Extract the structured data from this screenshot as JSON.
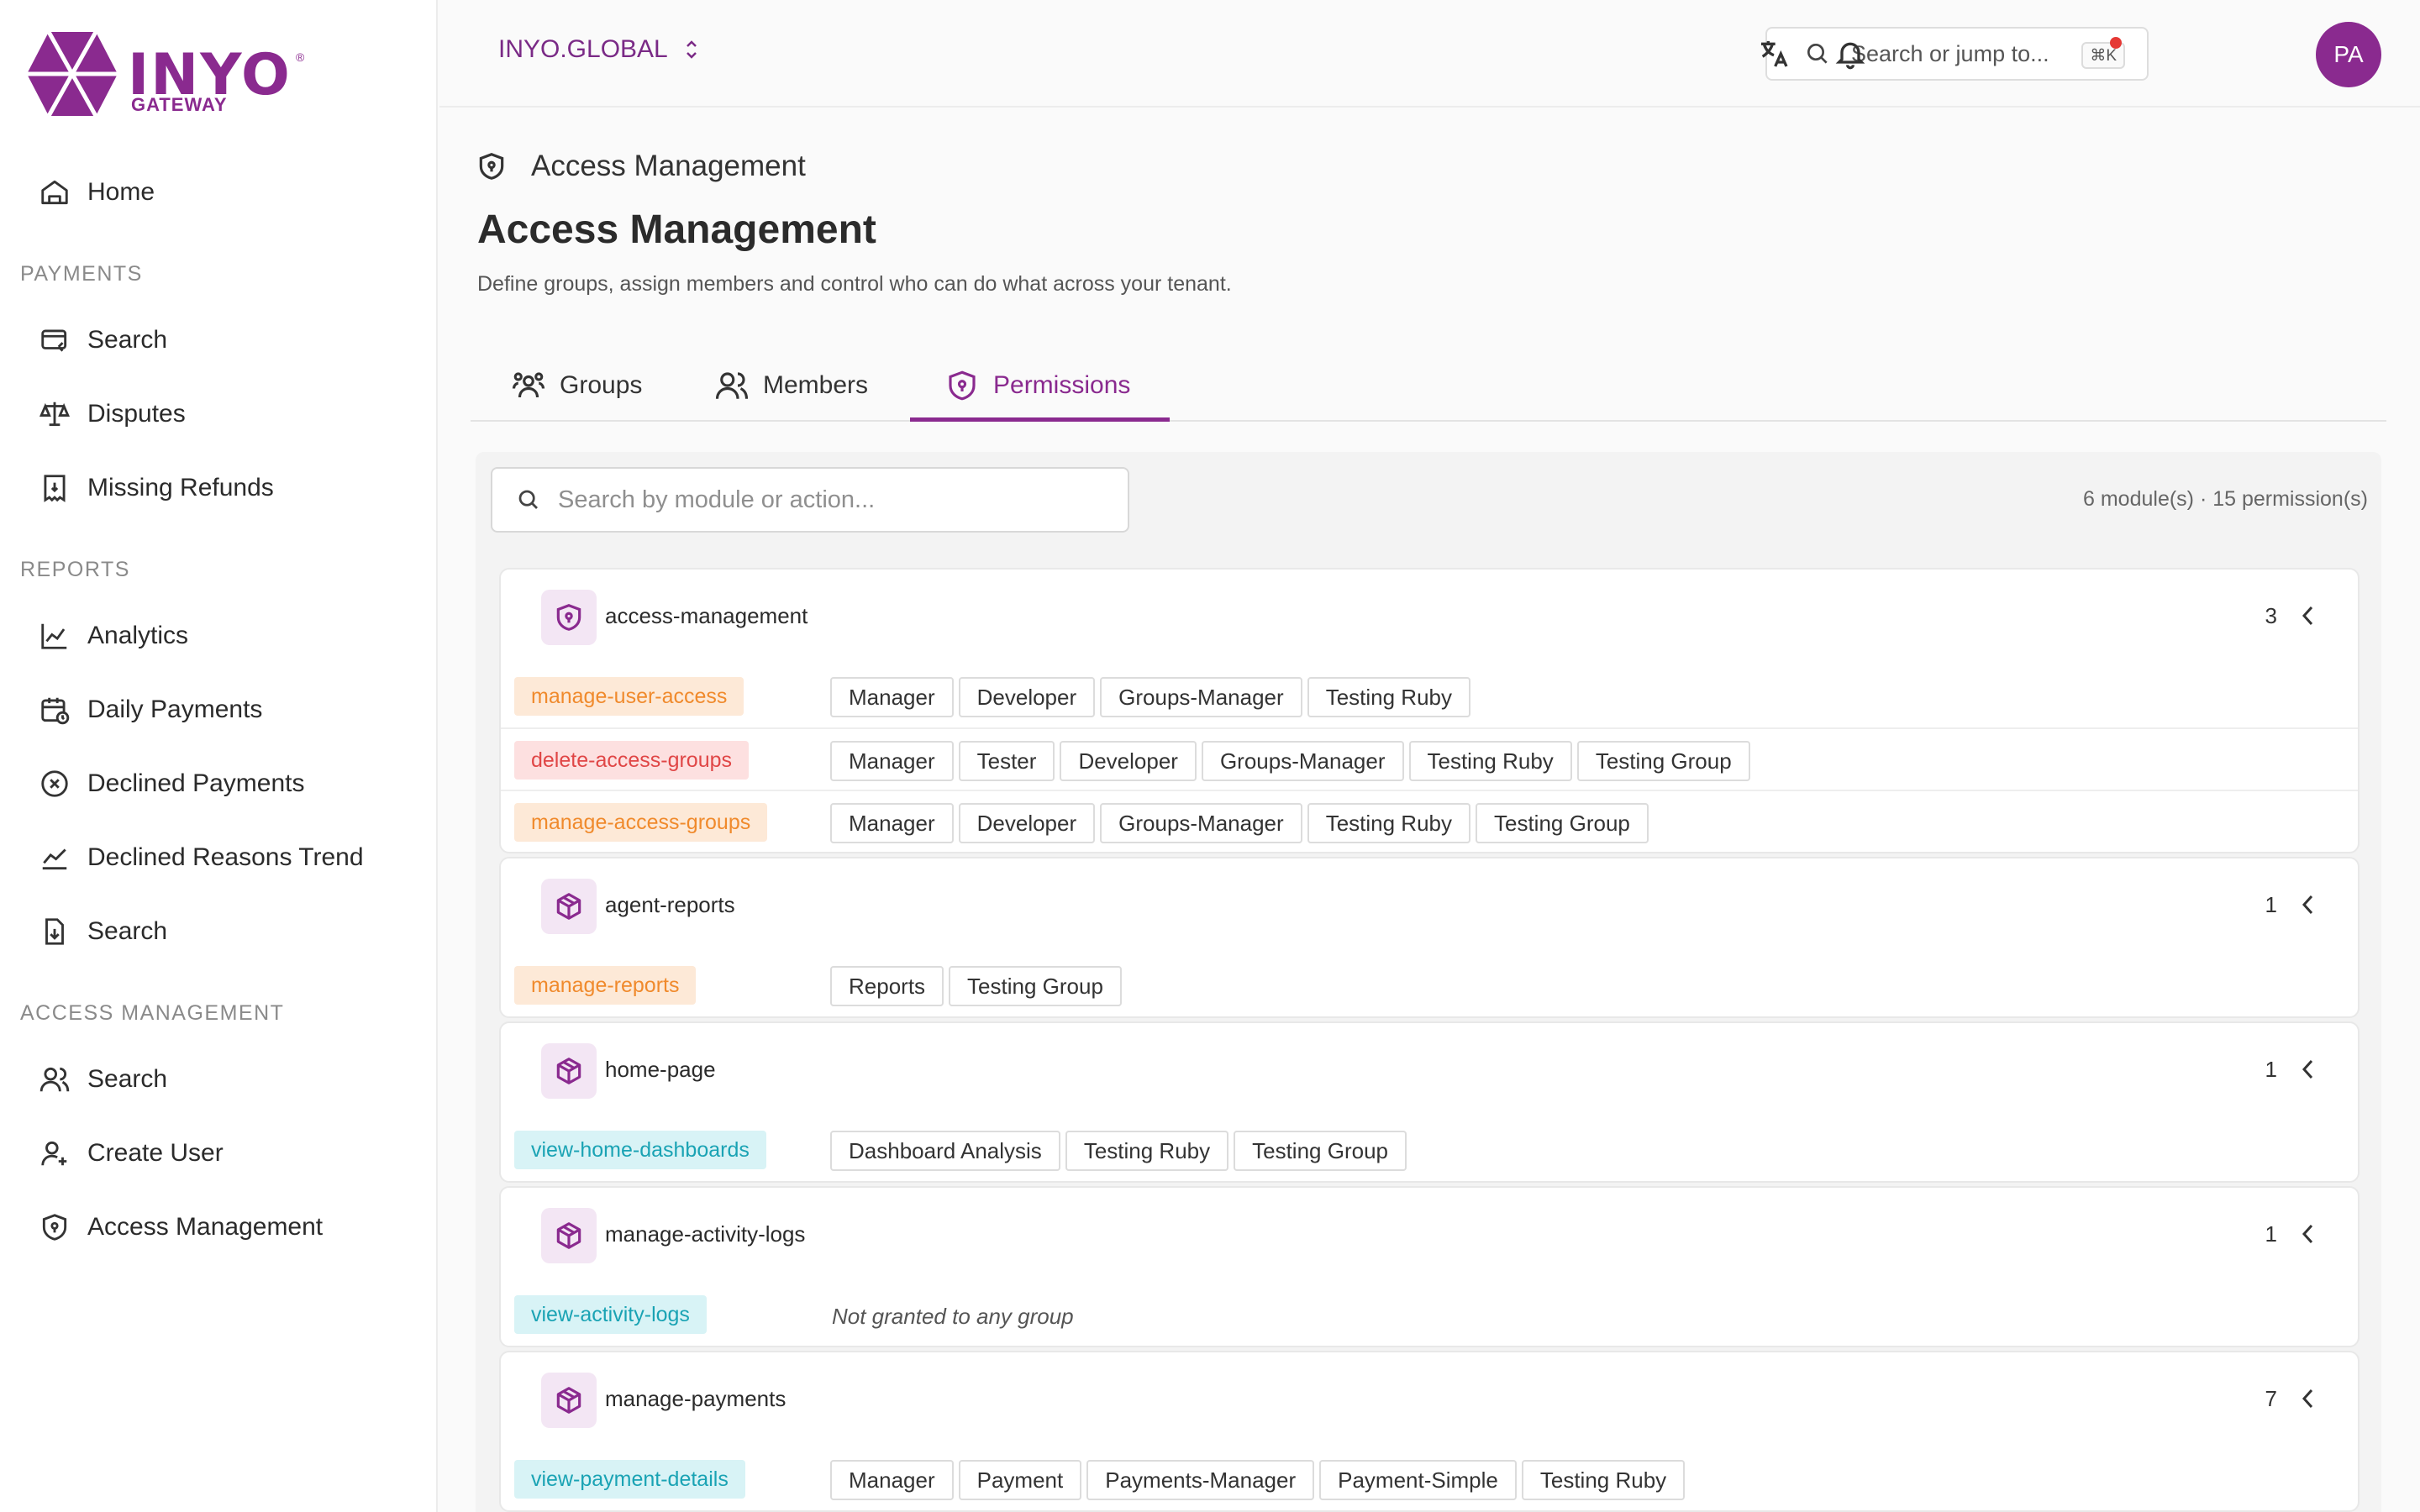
{
  "brand": {
    "word": "INYO",
    "sub": "GATEWAY",
    "reg": "®",
    "color": "#8a2a8f"
  },
  "sidebar": {
    "home": "Home",
    "sections": [
      {
        "title": "PAYMENTS",
        "items": [
          "Search",
          "Disputes",
          "Missing Refunds"
        ]
      },
      {
        "title": "REPORTS",
        "items": [
          "Analytics",
          "Daily Payments",
          "Declined Payments",
          "Declined Reasons Trend",
          "Search"
        ]
      },
      {
        "title": "ACCESS MANAGEMENT",
        "items": [
          "Search",
          "Create User",
          "Access Management"
        ]
      }
    ]
  },
  "topbar": {
    "tenant": "INYO.GLOBAL",
    "search_placeholder": "Search or jump to...",
    "shortcut": "⌘K",
    "avatar": "PA"
  },
  "page": {
    "breadcrumb": "Access Management",
    "title": "Access Management",
    "subtitle": "Define groups, assign members and control who can do what across your tenant.",
    "tabs": [
      "Groups",
      "Members",
      "Permissions"
    ],
    "active_tab": "Permissions"
  },
  "permissions": {
    "search_placeholder": "Search by module or action...",
    "summary": "6 module(s) · 15 permission(s)",
    "empty_text": "Not granted to any group",
    "modules": [
      {
        "name": "access-management",
        "count": "3",
        "icon": "shield-icon",
        "perms": [
          {
            "name": "manage-user-access",
            "color": "orange",
            "groups": [
              "Manager",
              "Developer",
              "Groups-Manager",
              "Testing Ruby"
            ]
          },
          {
            "name": "delete-access-groups",
            "color": "red",
            "groups": [
              "Manager",
              "Tester",
              "Developer",
              "Groups-Manager",
              "Testing Ruby",
              "Testing Group"
            ]
          },
          {
            "name": "manage-access-groups",
            "color": "orange",
            "groups": [
              "Manager",
              "Developer",
              "Groups-Manager",
              "Testing Ruby",
              "Testing Group"
            ]
          }
        ]
      },
      {
        "name": "agent-reports",
        "count": "1",
        "icon": "cube-icon",
        "perms": [
          {
            "name": "manage-reports",
            "color": "orange",
            "groups": [
              "Reports",
              "Testing Group"
            ]
          }
        ]
      },
      {
        "name": "home-page",
        "count": "1",
        "icon": "cube-icon",
        "perms": [
          {
            "name": "view-home-dashboards",
            "color": "cyan",
            "groups": [
              "Dashboard Analysis",
              "Testing Ruby",
              "Testing Group"
            ]
          }
        ]
      },
      {
        "name": "manage-activity-logs",
        "count": "1",
        "icon": "cube-icon",
        "perms": [
          {
            "name": "view-activity-logs",
            "color": "cyan",
            "groups": []
          }
        ]
      },
      {
        "name": "manage-payments",
        "count": "7",
        "icon": "cube-icon",
        "perms": [
          {
            "name": "view-payment-details",
            "color": "cyan",
            "groups": [
              "Manager",
              "Payment",
              "Payments-Manager",
              "Payment-Simple",
              "Testing Ruby"
            ]
          }
        ]
      }
    ]
  }
}
